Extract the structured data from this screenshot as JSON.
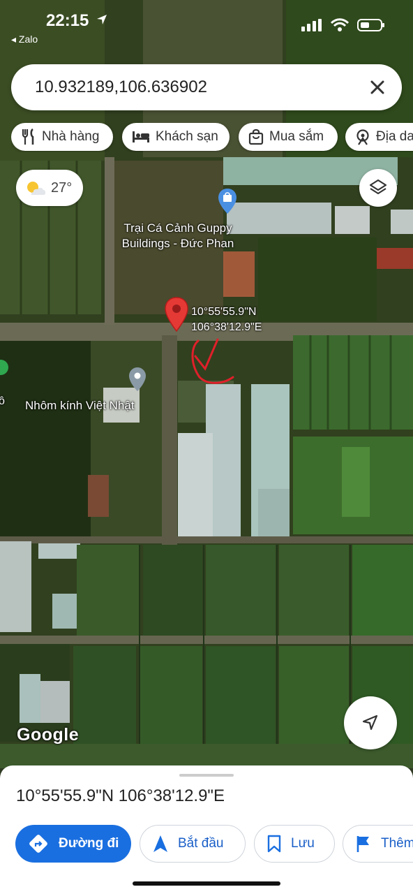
{
  "status_bar": {
    "time": "22:15",
    "back_label": "◂ Zalo"
  },
  "search": {
    "query": "10.932189,106.636902"
  },
  "chips": [
    {
      "label": "Nhà hàng",
      "icon": "restaurant-icon"
    },
    {
      "label": "Khách sạn",
      "icon": "hotel-icon"
    },
    {
      "label": "Mua sắm",
      "icon": "shopping-bag-icon"
    },
    {
      "label": "Địa da",
      "icon": "attraction-icon"
    }
  ],
  "weather": {
    "temperature": "27°"
  },
  "map_labels": {
    "place1_line1": "Trại Cá Cảnh Guppy",
    "place1_line2": "Buildings - Đức Phan",
    "place2": "Nhôm kính Việt Nhật",
    "pin_coord_line1": "10°55'55.9\"N",
    "pin_coord_line2": "106°38'12.9\"E",
    "edge_letter": "ô",
    "attribution": "Google"
  },
  "bottom_sheet": {
    "title": "10°55'55.9\"N 106°38'12.9\"E",
    "actions": [
      {
        "label": "Đường đi",
        "icon": "directions-icon"
      },
      {
        "label": "Bắt đầu",
        "icon": "navigation-arrow-icon"
      },
      {
        "label": "Lưu",
        "icon": "bookmark-icon"
      },
      {
        "label": "Thêm",
        "icon": "flag-icon"
      }
    ]
  },
  "colors": {
    "accent": "#1a6fe0",
    "pin": "#e53935",
    "annotation": "#e0202a"
  }
}
